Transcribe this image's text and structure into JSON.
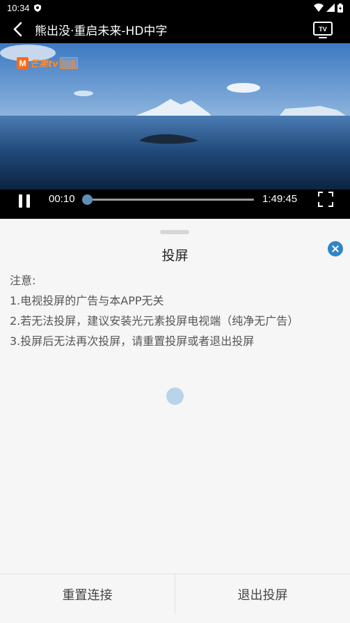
{
  "status_bar": {
    "time": "10:34"
  },
  "header": {
    "title": "熊出没·重启未来-HD中字",
    "back_icon": "chevron-left-icon",
    "cast_icon": "tv-icon"
  },
  "video": {
    "logo_text": "芒果tv",
    "logo_tag": "独播",
    "current_time": "00:10",
    "duration": "1:49:45",
    "progress": 0.0015
  },
  "sheet": {
    "title": "投屏",
    "notice_lines": [
      "注意:",
      "1.电视投屏的广告与本APP无关",
      "2.若无法投屏，建议安装光元素投屏电视端（纯净无广告）",
      "3.投屏后无法再次投屏，请重置投屏或者退出投屏"
    ],
    "buttons": {
      "reset": "重置连接",
      "exit": "退出投屏"
    }
  },
  "colors": {
    "accent": "#2f86c6",
    "video_bg": "#1f3f6a"
  }
}
